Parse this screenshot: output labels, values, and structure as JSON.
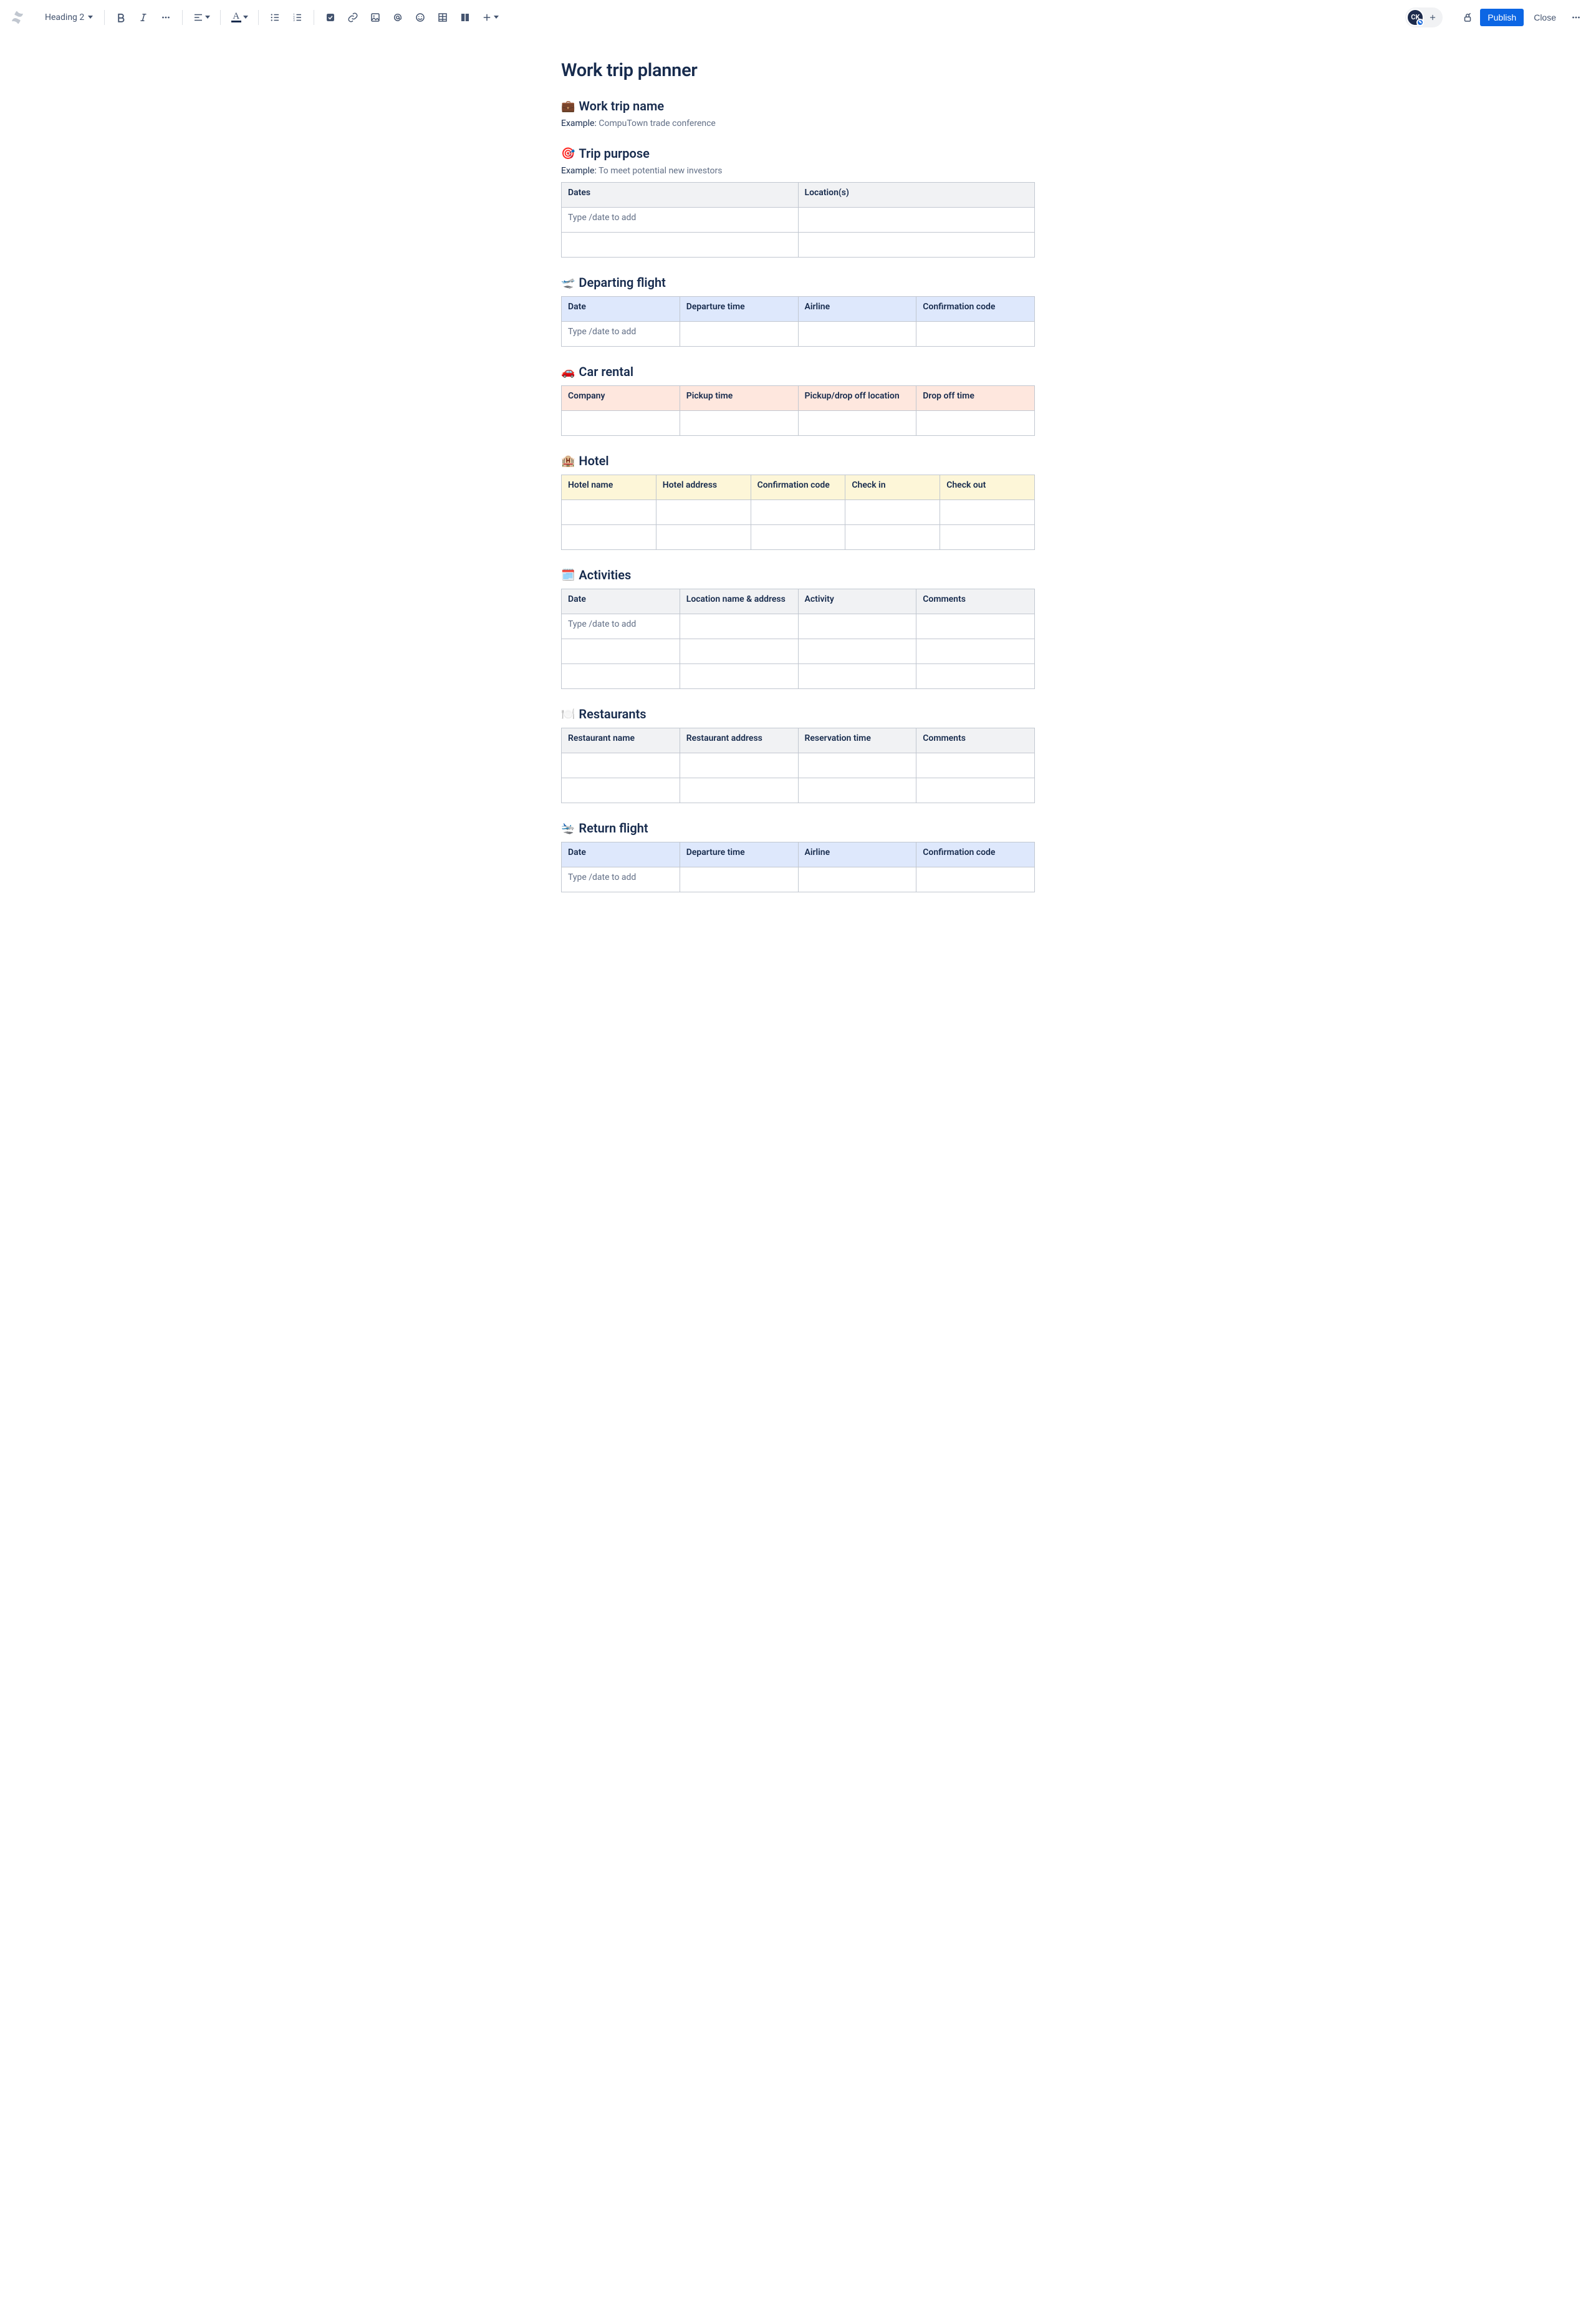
{
  "toolbar": {
    "textStyle": "Heading 2",
    "publish": "Publish",
    "close": "Close",
    "avatarInitials": "CK"
  },
  "page": {
    "title": "Work trip planner"
  },
  "sections": {
    "tripName": {
      "emoji": "💼",
      "heading": "Work trip name",
      "exampleLabel": "Example:",
      "exampleText": "CompuTown trade conference"
    },
    "purpose": {
      "emoji": "🎯",
      "heading": "Trip purpose",
      "exampleLabel": "Example:",
      "exampleText": "To meet potential new investors",
      "headers": [
        "Dates",
        "Location(s)"
      ],
      "rows": [
        [
          "Type /date to add",
          ""
        ],
        [
          "",
          ""
        ]
      ]
    },
    "departing": {
      "emoji": "🛫",
      "heading": "Departing flight",
      "headers": [
        "Date",
        "Departure time",
        "Airline",
        "Confirmation code"
      ],
      "rows": [
        [
          "Type /date to add",
          "",
          "",
          ""
        ]
      ]
    },
    "carRental": {
      "emoji": "🚗",
      "heading": "Car rental",
      "headers": [
        "Company",
        "Pickup time",
        "Pickup/drop off location",
        "Drop off time"
      ],
      "rows": [
        [
          "",
          "",
          "",
          ""
        ]
      ]
    },
    "hotel": {
      "emoji": "🏨",
      "heading": "Hotel",
      "headers": [
        "Hotel name",
        "Hotel address",
        "Confirmation code",
        "Check in",
        "Check out"
      ],
      "rows": [
        [
          "",
          "",
          "",
          "",
          ""
        ],
        [
          "",
          "",
          "",
          "",
          ""
        ]
      ]
    },
    "activities": {
      "emoji": "🗓️",
      "heading": "Activities",
      "headers": [
        "Date",
        "Location name & address",
        "Activity",
        "Comments"
      ],
      "rows": [
        [
          "Type /date to add",
          "",
          "",
          ""
        ],
        [
          "",
          "",
          "",
          ""
        ],
        [
          "",
          "",
          "",
          ""
        ]
      ]
    },
    "restaurants": {
      "emoji": "🍽️",
      "heading": "Restaurants",
      "headers": [
        "Restaurant name",
        "Restaurant address",
        "Reservation time",
        "Comments"
      ],
      "rows": [
        [
          "",
          "",
          "",
          ""
        ],
        [
          "",
          "",
          "",
          ""
        ]
      ]
    },
    "return": {
      "emoji": "🛬",
      "heading": "Return flight",
      "headers": [
        "Date",
        "Departure time",
        "Airline",
        "Confirmation code"
      ],
      "rows": [
        [
          "Type /date to add",
          "",
          "",
          ""
        ]
      ]
    }
  }
}
